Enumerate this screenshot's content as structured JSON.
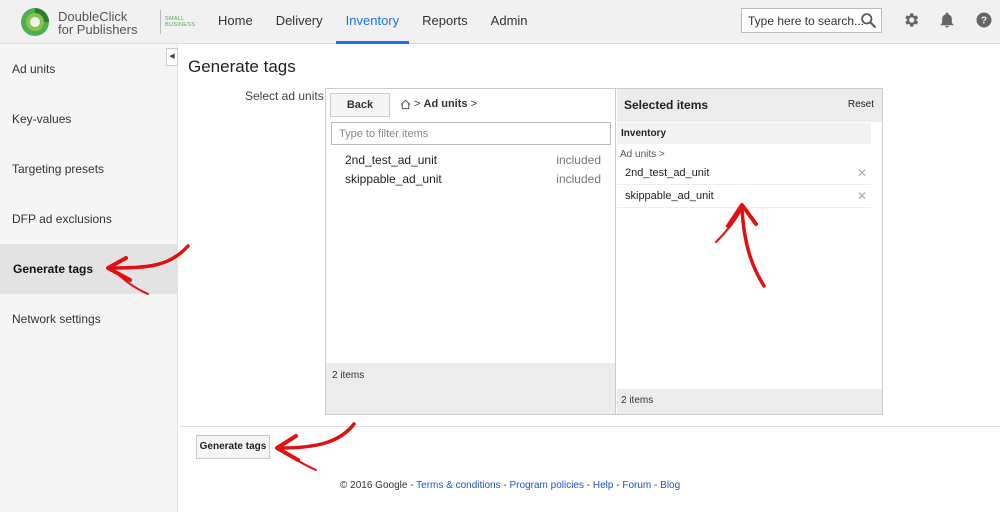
{
  "brand": {
    "line1": "DoubleClick",
    "line2": "for Publishers",
    "edition_line1": "SMALL",
    "edition_line2": "BUSINESS",
    "green": "#4caf50"
  },
  "nav": [
    {
      "label": "Home"
    },
    {
      "label": "Delivery"
    },
    {
      "label": "Inventory",
      "active": true
    },
    {
      "label": "Reports"
    },
    {
      "label": "Admin"
    }
  ],
  "search": {
    "placeholder": "Type here to search..."
  },
  "header_icons": [
    "gear-icon",
    "bell-icon",
    "help-icon"
  ],
  "sidebar": {
    "collapse_glyph": "◀",
    "items": [
      {
        "label": "Ad units"
      },
      {
        "label": "Key-values"
      },
      {
        "label": "Targeting presets"
      },
      {
        "label": "DFP ad exclusions"
      },
      {
        "label": "Generate tags",
        "active": true
      },
      {
        "label": "Network settings"
      }
    ]
  },
  "main": {
    "title": "Generate tags",
    "field_label": "Select ad units",
    "picker": {
      "back_label": "Back",
      "breadcrumb_separator": ">",
      "breadcrumb_current": "Ad units",
      "breadcrumb_trailing": ">",
      "filter_placeholder": "Type to filter items",
      "rows": [
        {
          "name": "2nd_test_ad_unit",
          "status": "included"
        },
        {
          "name": "skippable_ad_unit",
          "status": "included"
        }
      ],
      "left_count": "2 items",
      "selected": {
        "title": "Selected items",
        "reset_label": "Reset",
        "group_label": "Inventory",
        "sub_label": "Ad units >",
        "items": [
          {
            "name": "2nd_test_ad_unit"
          },
          {
            "name": "skippable_ad_unit"
          }
        ],
        "count": "2 items"
      }
    },
    "generate_button": "Generate tags"
  },
  "footer": {
    "copyright": "© 2016 Google",
    "sep": " - ",
    "links": [
      "Terms & conditions",
      "Program policies",
      "Help",
      "Forum",
      "Blog"
    ]
  },
  "colors": {
    "accent": "#1a73e8",
    "annotation_red": "#e01010",
    "link": "#1a56c8"
  }
}
